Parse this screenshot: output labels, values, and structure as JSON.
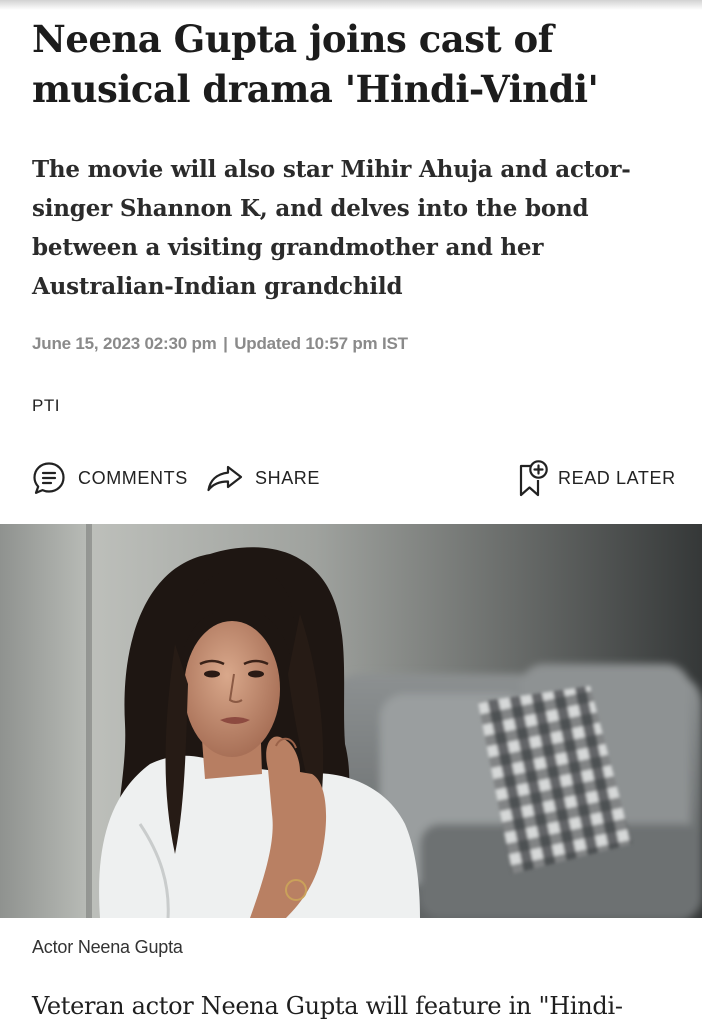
{
  "article": {
    "headline": "Neena Gupta joins cast of musical drama 'Hindi-Vindi'",
    "subheadline": "The movie will also star Mihir Ahuja and actor-singer Shannon K, and delves into the bond between a visiting grandmother and her Australian-Indian grandchild",
    "published": "June 15, 2023 02:30 pm",
    "separator": "|",
    "updated": "Updated 10:57 pm IST",
    "byline": "PTI",
    "image_caption": "Actor Neena Gupta",
    "body_first_line": "Veteran actor Neena Gupta will feature in \"Hindi-"
  },
  "actions": {
    "comments_label": "COMMENTS",
    "share_label": "SHARE",
    "read_later_label": "READ LATER"
  },
  "icons": {
    "comments": "comment-bubble-icon",
    "share": "share-arrow-icon",
    "read_later": "bookmark-add-icon"
  },
  "colors": {
    "text": "#1f1f1f",
    "meta": "#8a8a8a"
  }
}
